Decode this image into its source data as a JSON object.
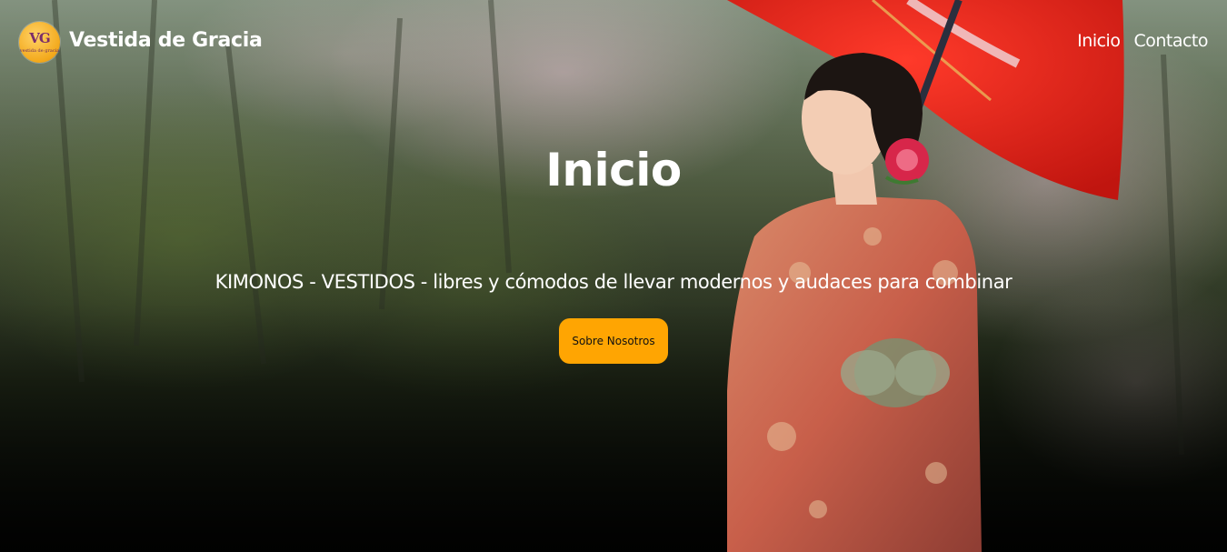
{
  "header": {
    "logo_text": "VG",
    "logo_subtext": "vestida de gracia",
    "brand": "Vestida de Gracia",
    "nav": [
      {
        "label": "Inicio"
      },
      {
        "label": "Contacto"
      }
    ]
  },
  "hero": {
    "title": "Inicio",
    "tagline": "KIMONOS - VESTIDOS - libres y cómodos de llevar modernos y audaces para combinar",
    "cta_label": "Sobre Nosotros",
    "image_description": "photo-woman-kimono-red-umbrella",
    "colors": {
      "cta_background": "#ffa502",
      "text": "#ffffff",
      "umbrella_red": "#d8221c",
      "logo_gold": "#f3a91c"
    }
  }
}
